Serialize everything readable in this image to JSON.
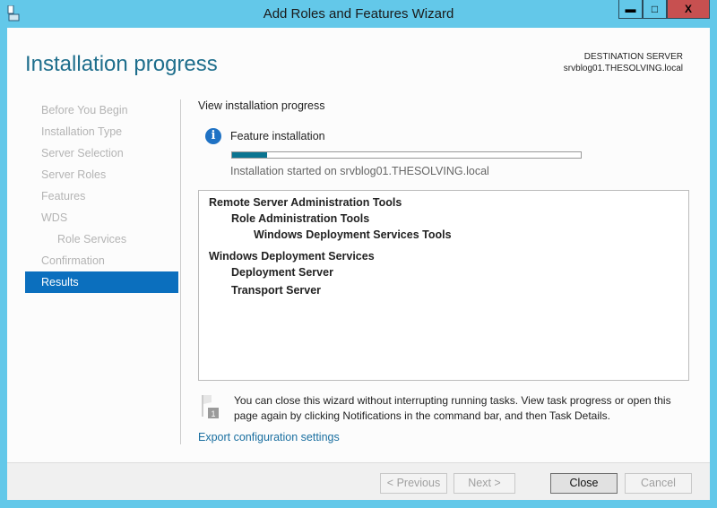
{
  "window": {
    "title": "Add Roles and Features Wizard",
    "minimize": "▬",
    "maximize": "□",
    "close": "X"
  },
  "header": {
    "title": "Installation progress",
    "dest_label": "DESTINATION SERVER",
    "dest_server": "srvblog01.THESOLVING.local"
  },
  "nav": {
    "items": [
      {
        "label": "Before You Begin"
      },
      {
        "label": "Installation Type"
      },
      {
        "label": "Server Selection"
      },
      {
        "label": "Server Roles"
      },
      {
        "label": "Features"
      },
      {
        "label": "WDS"
      },
      {
        "label": "Role Services"
      },
      {
        "label": "Confirmation"
      },
      {
        "label": "Results"
      }
    ]
  },
  "main": {
    "heading": "View installation progress",
    "status_icon": "info-icon",
    "status_title": "Feature installation",
    "progress_percent": 10,
    "status_text": "Installation started on srvblog01.THESOLVING.local",
    "features": [
      {
        "label": "Remote Server Administration Tools",
        "level": 1
      },
      {
        "label": "Role Administration Tools",
        "level": 2
      },
      {
        "label": "Windows Deployment Services Tools",
        "level": 3
      },
      {
        "label": "Windows Deployment Services",
        "level": 1
      },
      {
        "label": "Deployment Server",
        "level": 2
      },
      {
        "label": "Transport Server",
        "level": 2
      }
    ],
    "notification_badge": "1",
    "note": "You can close this wizard without interrupting running tasks. View task progress or open this page again by clicking Notifications in the command bar, and then Task Details.",
    "export_link": "Export configuration settings"
  },
  "footer": {
    "previous": "< Previous",
    "next": "Next >",
    "close": "Close",
    "cancel": "Cancel"
  },
  "colors": {
    "titlebar": "#63c8e9",
    "accent": "#0b6fbe",
    "progress": "#0b7490",
    "close_button": "#c75050"
  }
}
